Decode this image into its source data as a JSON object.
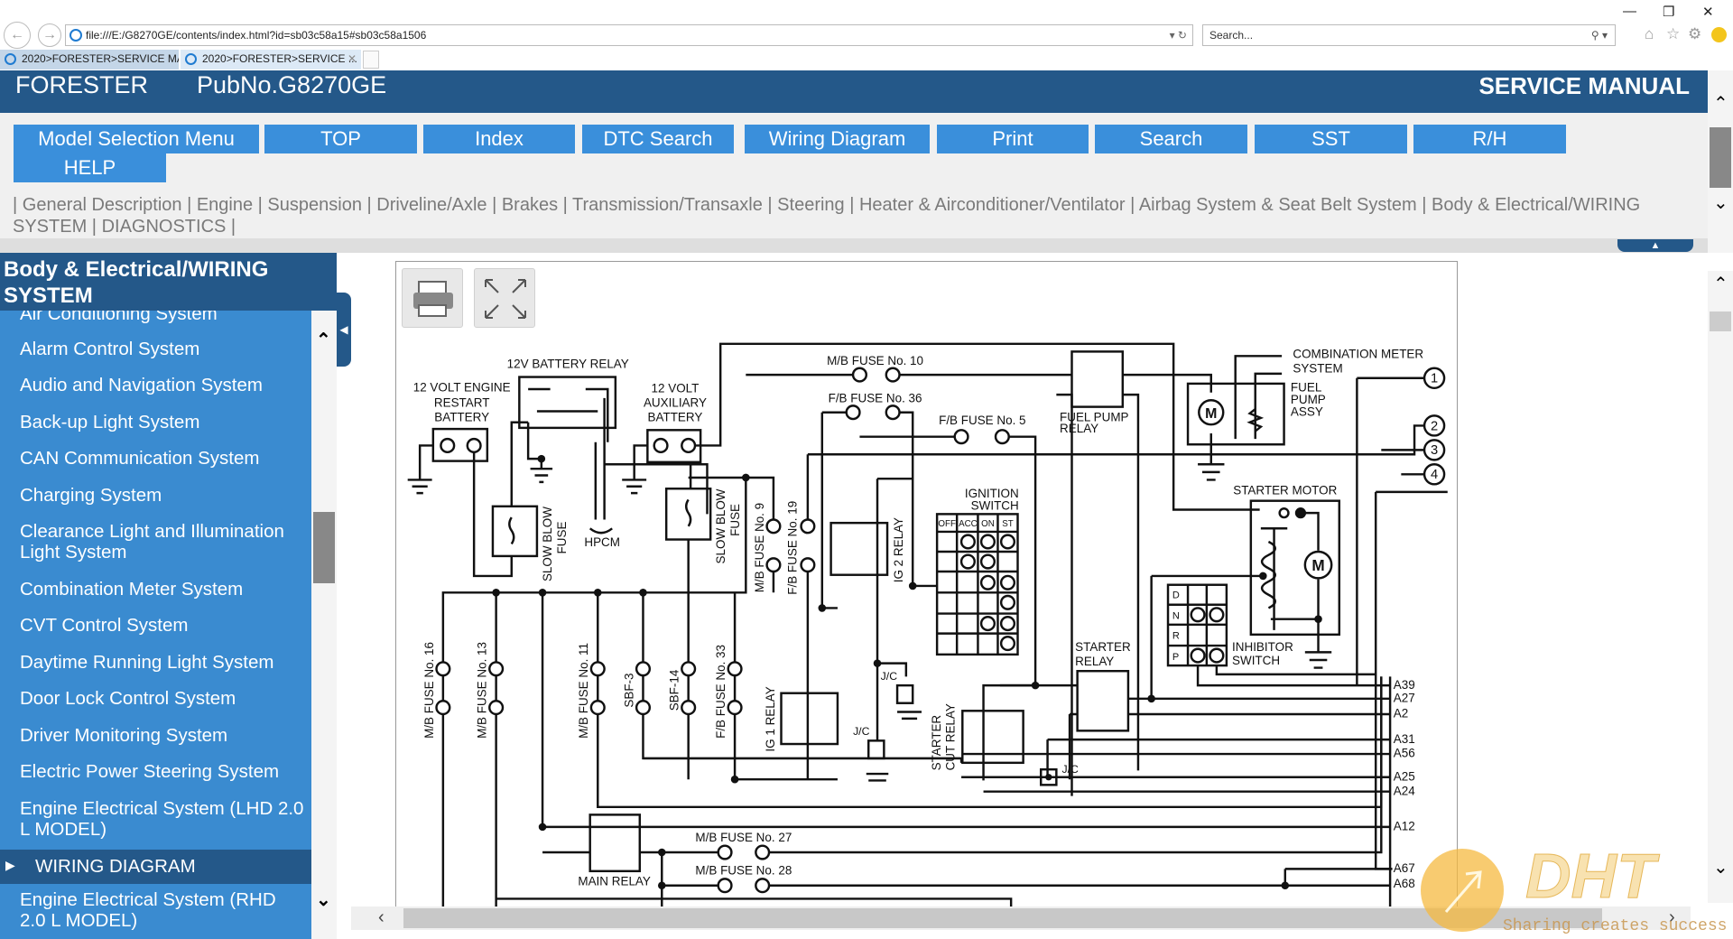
{
  "browser": {
    "address": "file:///E:/G8270GE/contents/index.html?id=sb03c58a15#sb03c58a1506",
    "search_placeholder": "Search...",
    "tabs": [
      {
        "label": "2020>FORESTER>SERVICE MA..."
      },
      {
        "label": "2020>FORESTER>SERVICE ..."
      }
    ]
  },
  "header": {
    "brand": "FORESTER",
    "pub_no": "PubNo.G8270GE",
    "title": "SERVICE MANUAL"
  },
  "nav": {
    "buttons": [
      "Model Selection Menu",
      "TOP",
      "Index",
      "DTC Search",
      "Wiring Diagram",
      "Print",
      "Search",
      "SST",
      "R/H",
      "HELP"
    ]
  },
  "categories": [
    "General Description",
    "Engine",
    "Suspension",
    "Driveline/Axle",
    "Brakes",
    "Transmission/Transaxle",
    "Steering",
    "Heater & Airconditioner/Ventilator",
    "Airbag System & Seat Belt System",
    "Body & Electrical/WIRING SYSTEM",
    "DIAGNOSTICS"
  ],
  "sidebar": {
    "title": "Body & Electrical/WIRING SYSTEM",
    "items": [
      "Air Conditioning System",
      "Alarm Control System",
      "Audio and Navigation System",
      "Back-up Light System",
      "CAN Communication System",
      "Charging System",
      "Clearance Light and Illumination Light System",
      "Combination Meter System",
      "CVT Control System",
      "Daytime Running Light System",
      "Door Lock Control System",
      "Driver Monitoring System",
      "Electric Power Steering System",
      "Engine Electrical System (LHD 2.0 L MODEL)",
      "WIRING DIAGRAM",
      "Engine Electrical System (RHD 2.0 L MODEL)"
    ],
    "selected": "WIRING DIAGRAM"
  },
  "diagram": {
    "engine_battery": [
      "12 VOLT ENGINE",
      "RESTART",
      "BATTERY"
    ],
    "battery_relay": "12V BATTERY RELAY",
    "aux_battery": [
      "12 VOLT",
      "AUXILIARY",
      "BATTERY"
    ],
    "slow_blow_fuse": [
      "SLOW BLOW",
      "FUSE"
    ],
    "hpcm": "HPCM",
    "mb_fuse_10": "M/B FUSE No. 10",
    "fb_fuse_36": "F/B FUSE No. 36",
    "fb_fuse_5": "F/B FUSE No. 5",
    "mb_fuse_9": "M/B FUSE No. 9",
    "fb_fuse_19": "F/B FUSE No. 19",
    "ig2_relay": "IG 2 RELAY",
    "ignition_switch": [
      "IGNITION",
      "SWITCH"
    ],
    "ign_cols": [
      "OFF",
      "ACC",
      "ON",
      "ST"
    ],
    "fuel_pump_relay": [
      "FUEL PUMP",
      "RELAY"
    ],
    "combination_meter": [
      "COMBINATION METER",
      "SYSTEM"
    ],
    "fuel_pump_assy": [
      "FUEL",
      "PUMP",
      "ASSY"
    ],
    "starter_motor": "STARTER MOTOR",
    "motor": "M",
    "inhibitor_rows": [
      "D",
      "N",
      "R",
      "P"
    ],
    "inhibitor_switch": [
      "INHIBITOR",
      "SWITCH"
    ],
    "starter_relay": [
      "STARTER",
      "RELAY"
    ],
    "starter_cut_relay": [
      "STARTER",
      "CUT RELAY"
    ],
    "ig1_relay": "IG 1 RELAY",
    "jc": "J/C",
    "mb_fuse_16": "M/B FUSE No. 16",
    "mb_fuse_13": "M/B FUSE No. 13",
    "mb_fuse_11": "M/B FUSE No. 11",
    "sbf3": "SBF-3",
    "sbf14": "SBF-14",
    "fb_fuse_33": "F/B FUSE No. 33",
    "main_relay": "MAIN RELAY",
    "mb_fuse_27": "M/B FUSE No. 27",
    "mb_fuse_28": "M/B FUSE No. 28",
    "connectors": [
      "1",
      "2",
      "3",
      "4"
    ],
    "pins": [
      "A39",
      "A27",
      "A2",
      "A31",
      "A56",
      "A25",
      "A24",
      "A12",
      "A67",
      "A68"
    ]
  },
  "watermark": {
    "logo": "DHT",
    "slogan": "Sharing creates success",
    "color": "#f5b940"
  },
  "colors": {
    "header": "#245889",
    "nav_button": "#3a8fdb",
    "sidebar": "#3a8bd0"
  }
}
